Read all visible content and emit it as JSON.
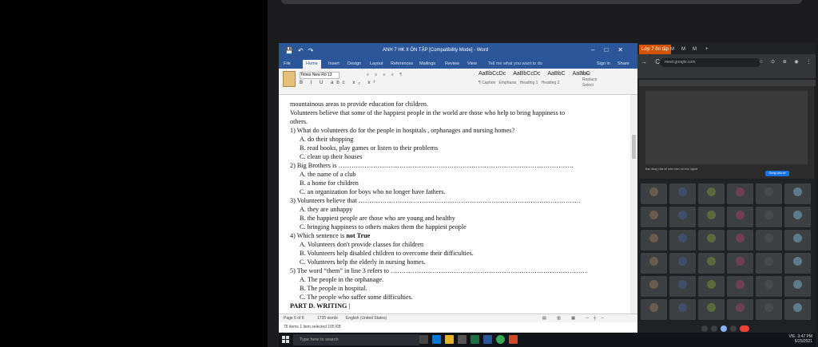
{
  "word": {
    "title": "ANH 7 HK II ÔN TẬP [Compatibility Mode] - Word",
    "tabs": [
      "File",
      "Home",
      "Insert",
      "Design",
      "Layout",
      "References",
      "Mailings",
      "Review",
      "View"
    ],
    "tell_me": "Tell me what you want to do",
    "signin": "Sign in",
    "share": "Share",
    "font_name": "Times New Ro",
    "font_size": "13",
    "styles": [
      "AaBbCcDc",
      "AaBbCcDc",
      "AaBbC",
      "AaBbC"
    ],
    "style_names": [
      "¶ Caption",
      "Emphasis",
      "Heading 1",
      "Heading 2"
    ],
    "find": "Find",
    "replace": "Replace",
    "select": "Select",
    "status_left": "Page 6 of 6",
    "status_words": "1735 words",
    "status_lang": "English (United States)",
    "status2": "75 items    1 item selected 105 KB",
    "lines": [
      {
        "t": "mountainous areas to provide education for children.",
        "i": 0
      },
      {
        "t": "Volunteers believe that some of the happiest people in the world are those who help to bring happiness to",
        "i": 0
      },
      {
        "t": "others.",
        "i": 0
      },
      {
        "t": "1) What do volunteers do for the people in hospitals , orphanages and  nursing homes?",
        "i": 0
      },
      {
        "t": "A. do their shopping",
        "i": 1
      },
      {
        "t": "B. read books, play games or listen to their problems",
        "i": 1
      },
      {
        "t": "C. clean up their houses",
        "i": 1
      },
      {
        "t": "2) Big Brothers is ………………………………………………………………………………………………",
        "i": 0
      },
      {
        "t": "A. the name of a club",
        "i": 1
      },
      {
        "t": "B. a home for children",
        "i": 1
      },
      {
        "t": "C. an organization for boys who no longer have fathers.",
        "i": 1
      },
      {
        "t": "3) Volunteers  believe that …………………………………………………………………………………………",
        "i": 0
      },
      {
        "t": "A. they are unhappy",
        "i": 1
      },
      {
        "t": "B. the happiest people are those who are young and healthy",
        "i": 1
      },
      {
        "t": "C. bringing happiness to others makes them the happiest people",
        "i": 1
      }
    ],
    "q4_prefix": "4) Which sentence is ",
    "q4_bold": "not True",
    "lines2": [
      {
        "t": "A. Volunteers don't provide classes for children",
        "i": 1
      },
      {
        "t": "B. Volunteers help disabled children to overcome their difficulties.",
        "i": 1
      },
      {
        "t": "C. Volunteers help the elderly in  nursing homes.",
        "i": 1
      },
      {
        "t": "5) The word “them” in line 3 refers to ………………………………………………………………………………",
        "i": 0
      },
      {
        "t": "A. The people in the orphanage.",
        "i": 1
      },
      {
        "t": "B. The people in hospital.",
        "i": 1
      },
      {
        "t": "C. The people who suffer some difficulties.",
        "i": 1
      }
    ],
    "part_d": "PART D. WRITING"
  },
  "browser": {
    "tabs": [
      "Lớp 7 ôn tập",
      "M",
      "M",
      "M",
      "+"
    ],
    "url": "meet.google.com",
    "share_text": "Bạn đang chia sẻ màn hình với mọi người",
    "share_button": "Dừng chia sẻ"
  },
  "taskbar": {
    "search_placeholder": "Type here to search",
    "time": "3:47 PM",
    "date": "5/25/2021",
    "lang": "VIE"
  }
}
